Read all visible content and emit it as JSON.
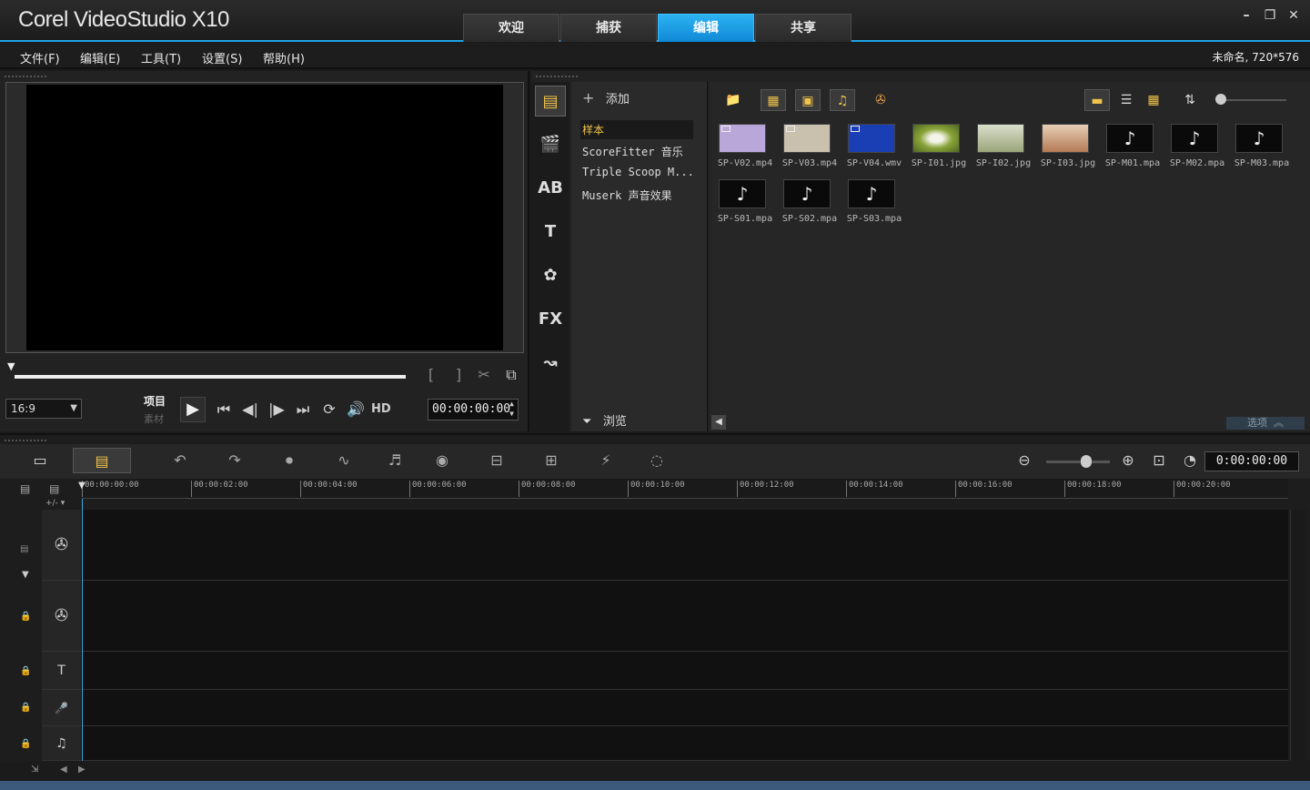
{
  "app": {
    "title": "Corel VideoStudio X10",
    "tabs": [
      {
        "label": "欢迎"
      },
      {
        "label": "捕获"
      },
      {
        "label": "编辑"
      },
      {
        "label": "共享"
      }
    ],
    "active_tab": "编辑",
    "window_buttons": {
      "minimize": "–",
      "restore": "❐",
      "close": "✕"
    }
  },
  "menu": {
    "items": [
      "文件(F)",
      "编辑(E)",
      "工具(T)",
      "设置(S)",
      "帮助(H)"
    ],
    "project_info": "未命名, 720*576"
  },
  "player": {
    "aspect_ratio": "16:9",
    "mode_project": "项目",
    "mode_clip": "素材",
    "timecode": "00:00:00:00",
    "hd_label": "HD",
    "mark_in": "[",
    "mark_out": "]"
  },
  "library": {
    "add_label": "添加",
    "browse_label": "浏览",
    "options_label": "选项",
    "folders": [
      {
        "label": "样本",
        "selected": true
      },
      {
        "label": "ScoreFitter 音乐",
        "selected": false
      },
      {
        "label": "Triple Scoop M...",
        "selected": false
      },
      {
        "label": "Muserk 声音效果",
        "selected": false
      }
    ],
    "side_icons": [
      "media-icon",
      "instant-project-icon",
      "transition-icon",
      "title-icon",
      "graphics-icon",
      "filter-icon",
      "path-icon"
    ],
    "fx_label": "FX",
    "items": [
      {
        "name": "SP-V02.mp4",
        "kind": "video",
        "color": "#b9a7d9"
      },
      {
        "name": "SP-V03.mp4",
        "kind": "video",
        "color": "#c9c0ad"
      },
      {
        "name": "SP-V04.wmv",
        "kind": "video",
        "color": "#1a3fb5"
      },
      {
        "name": "SP-I01.jpg",
        "kind": "image",
        "color": "#8aa53a"
      },
      {
        "name": "SP-I02.jpg",
        "kind": "image",
        "color": "#b9c19d"
      },
      {
        "name": "SP-I03.jpg",
        "kind": "image",
        "color": "#c79572"
      },
      {
        "name": "SP-M01.mpa",
        "kind": "audio",
        "color": "#0a0a0a"
      },
      {
        "name": "SP-M02.mpa",
        "kind": "audio",
        "color": "#0a0a0a"
      },
      {
        "name": "SP-M03.mpa",
        "kind": "audio",
        "color": "#0a0a0a"
      },
      {
        "name": "SP-S01.mpa",
        "kind": "audio",
        "color": "#0a0a0a"
      },
      {
        "name": "SP-S02.mpa",
        "kind": "audio",
        "color": "#0a0a0a"
      },
      {
        "name": "SP-S03.mpa",
        "kind": "audio",
        "color": "#0a0a0a"
      }
    ]
  },
  "timeline": {
    "timecode": "0:00:00:00",
    "ruler_ticks": [
      "00:00:00:00",
      "00:00:02:00",
      "00:00:04:00",
      "00:00:06:00",
      "00:00:08:00",
      "00:00:10:00",
      "00:00:12:00",
      "00:00:14:00",
      "00:00:16:00",
      "00:00:18:00",
      "00:00:20:00"
    ],
    "track_add_label": "+/-",
    "tracks": [
      {
        "name": "video-track",
        "icon": "✇"
      },
      {
        "name": "overlay-track",
        "icon": "✇"
      },
      {
        "name": "title-track",
        "icon": "T"
      },
      {
        "name": "voice-track",
        "icon": "🎤"
      },
      {
        "name": "music-track",
        "icon": "♫"
      }
    ]
  },
  "colors": {
    "accent": "#1fa3e8",
    "selected_folder": "#f0c34a"
  }
}
